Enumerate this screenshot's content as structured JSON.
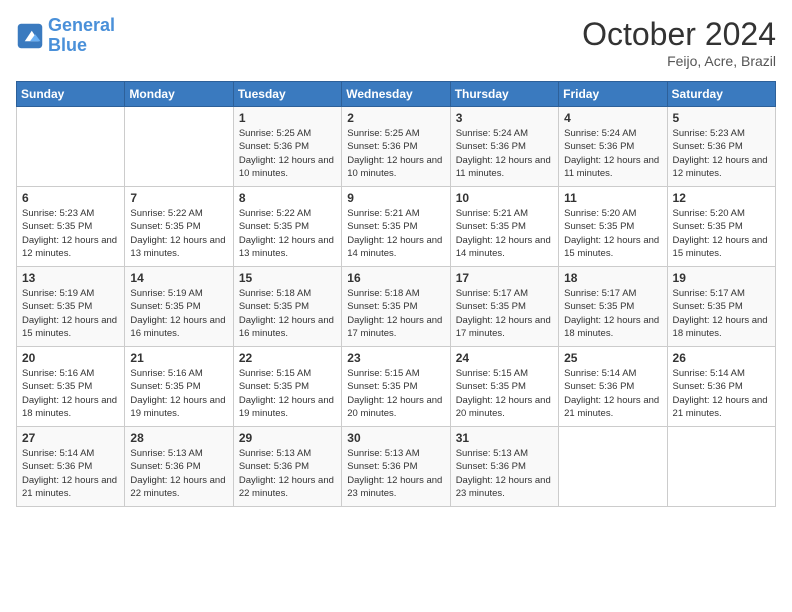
{
  "logo": {
    "line1": "General",
    "line2": "Blue"
  },
  "title": "October 2024",
  "subtitle": "Feijo, Acre, Brazil",
  "days_header": [
    "Sunday",
    "Monday",
    "Tuesday",
    "Wednesday",
    "Thursday",
    "Friday",
    "Saturday"
  ],
  "weeks": [
    [
      {
        "day": "",
        "sunrise": "",
        "sunset": "",
        "daylight": ""
      },
      {
        "day": "",
        "sunrise": "",
        "sunset": "",
        "daylight": ""
      },
      {
        "day": "1",
        "sunrise": "Sunrise: 5:25 AM",
        "sunset": "Sunset: 5:36 PM",
        "daylight": "Daylight: 12 hours and 10 minutes."
      },
      {
        "day": "2",
        "sunrise": "Sunrise: 5:25 AM",
        "sunset": "Sunset: 5:36 PM",
        "daylight": "Daylight: 12 hours and 10 minutes."
      },
      {
        "day": "3",
        "sunrise": "Sunrise: 5:24 AM",
        "sunset": "Sunset: 5:36 PM",
        "daylight": "Daylight: 12 hours and 11 minutes."
      },
      {
        "day": "4",
        "sunrise": "Sunrise: 5:24 AM",
        "sunset": "Sunset: 5:36 PM",
        "daylight": "Daylight: 12 hours and 11 minutes."
      },
      {
        "day": "5",
        "sunrise": "Sunrise: 5:23 AM",
        "sunset": "Sunset: 5:36 PM",
        "daylight": "Daylight: 12 hours and 12 minutes."
      }
    ],
    [
      {
        "day": "6",
        "sunrise": "Sunrise: 5:23 AM",
        "sunset": "Sunset: 5:35 PM",
        "daylight": "Daylight: 12 hours and 12 minutes."
      },
      {
        "day": "7",
        "sunrise": "Sunrise: 5:22 AM",
        "sunset": "Sunset: 5:35 PM",
        "daylight": "Daylight: 12 hours and 13 minutes."
      },
      {
        "day": "8",
        "sunrise": "Sunrise: 5:22 AM",
        "sunset": "Sunset: 5:35 PM",
        "daylight": "Daylight: 12 hours and 13 minutes."
      },
      {
        "day": "9",
        "sunrise": "Sunrise: 5:21 AM",
        "sunset": "Sunset: 5:35 PM",
        "daylight": "Daylight: 12 hours and 14 minutes."
      },
      {
        "day": "10",
        "sunrise": "Sunrise: 5:21 AM",
        "sunset": "Sunset: 5:35 PM",
        "daylight": "Daylight: 12 hours and 14 minutes."
      },
      {
        "day": "11",
        "sunrise": "Sunrise: 5:20 AM",
        "sunset": "Sunset: 5:35 PM",
        "daylight": "Daylight: 12 hours and 15 minutes."
      },
      {
        "day": "12",
        "sunrise": "Sunrise: 5:20 AM",
        "sunset": "Sunset: 5:35 PM",
        "daylight": "Daylight: 12 hours and 15 minutes."
      }
    ],
    [
      {
        "day": "13",
        "sunrise": "Sunrise: 5:19 AM",
        "sunset": "Sunset: 5:35 PM",
        "daylight": "Daylight: 12 hours and 15 minutes."
      },
      {
        "day": "14",
        "sunrise": "Sunrise: 5:19 AM",
        "sunset": "Sunset: 5:35 PM",
        "daylight": "Daylight: 12 hours and 16 minutes."
      },
      {
        "day": "15",
        "sunrise": "Sunrise: 5:18 AM",
        "sunset": "Sunset: 5:35 PM",
        "daylight": "Daylight: 12 hours and 16 minutes."
      },
      {
        "day": "16",
        "sunrise": "Sunrise: 5:18 AM",
        "sunset": "Sunset: 5:35 PM",
        "daylight": "Daylight: 12 hours and 17 minutes."
      },
      {
        "day": "17",
        "sunrise": "Sunrise: 5:17 AM",
        "sunset": "Sunset: 5:35 PM",
        "daylight": "Daylight: 12 hours and 17 minutes."
      },
      {
        "day": "18",
        "sunrise": "Sunrise: 5:17 AM",
        "sunset": "Sunset: 5:35 PM",
        "daylight": "Daylight: 12 hours and 18 minutes."
      },
      {
        "day": "19",
        "sunrise": "Sunrise: 5:17 AM",
        "sunset": "Sunset: 5:35 PM",
        "daylight": "Daylight: 12 hours and 18 minutes."
      }
    ],
    [
      {
        "day": "20",
        "sunrise": "Sunrise: 5:16 AM",
        "sunset": "Sunset: 5:35 PM",
        "daylight": "Daylight: 12 hours and 18 minutes."
      },
      {
        "day": "21",
        "sunrise": "Sunrise: 5:16 AM",
        "sunset": "Sunset: 5:35 PM",
        "daylight": "Daylight: 12 hours and 19 minutes."
      },
      {
        "day": "22",
        "sunrise": "Sunrise: 5:15 AM",
        "sunset": "Sunset: 5:35 PM",
        "daylight": "Daylight: 12 hours and 19 minutes."
      },
      {
        "day": "23",
        "sunrise": "Sunrise: 5:15 AM",
        "sunset": "Sunset: 5:35 PM",
        "daylight": "Daylight: 12 hours and 20 minutes."
      },
      {
        "day": "24",
        "sunrise": "Sunrise: 5:15 AM",
        "sunset": "Sunset: 5:35 PM",
        "daylight": "Daylight: 12 hours and 20 minutes."
      },
      {
        "day": "25",
        "sunrise": "Sunrise: 5:14 AM",
        "sunset": "Sunset: 5:36 PM",
        "daylight": "Daylight: 12 hours and 21 minutes."
      },
      {
        "day": "26",
        "sunrise": "Sunrise: 5:14 AM",
        "sunset": "Sunset: 5:36 PM",
        "daylight": "Daylight: 12 hours and 21 minutes."
      }
    ],
    [
      {
        "day": "27",
        "sunrise": "Sunrise: 5:14 AM",
        "sunset": "Sunset: 5:36 PM",
        "daylight": "Daylight: 12 hours and 21 minutes."
      },
      {
        "day": "28",
        "sunrise": "Sunrise: 5:13 AM",
        "sunset": "Sunset: 5:36 PM",
        "daylight": "Daylight: 12 hours and 22 minutes."
      },
      {
        "day": "29",
        "sunrise": "Sunrise: 5:13 AM",
        "sunset": "Sunset: 5:36 PM",
        "daylight": "Daylight: 12 hours and 22 minutes."
      },
      {
        "day": "30",
        "sunrise": "Sunrise: 5:13 AM",
        "sunset": "Sunset: 5:36 PM",
        "daylight": "Daylight: 12 hours and 23 minutes."
      },
      {
        "day": "31",
        "sunrise": "Sunrise: 5:13 AM",
        "sunset": "Sunset: 5:36 PM",
        "daylight": "Daylight: 12 hours and 23 minutes."
      },
      {
        "day": "",
        "sunrise": "",
        "sunset": "",
        "daylight": ""
      },
      {
        "day": "",
        "sunrise": "",
        "sunset": "",
        "daylight": ""
      }
    ]
  ]
}
